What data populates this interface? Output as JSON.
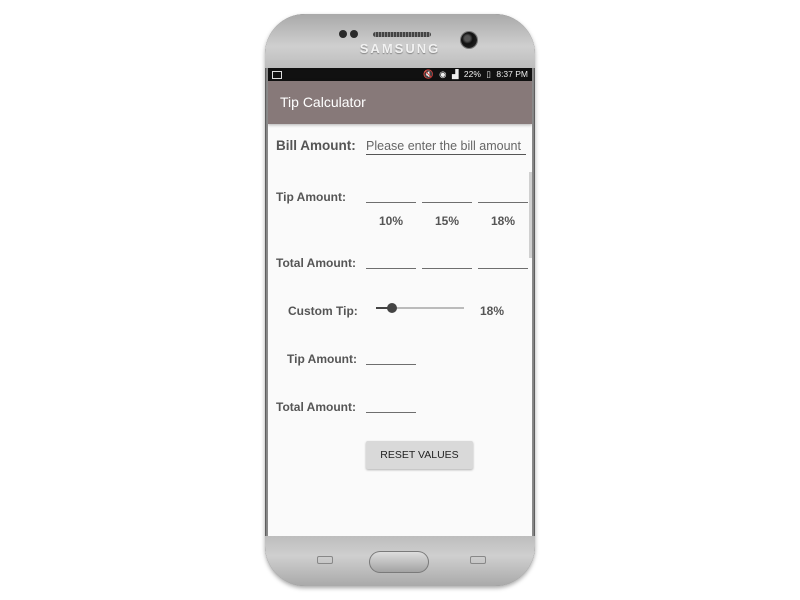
{
  "device": {
    "brand": "SAMSUNG"
  },
  "status_bar": {
    "battery": "22%",
    "time": "8:37 PM"
  },
  "app": {
    "title": "Tip Calculator"
  },
  "form": {
    "bill_label": "Bill Amount:",
    "bill_placeholder": "Please enter the bill amount",
    "bill_value": "",
    "tip_label": "Tip Amount:",
    "percentages": [
      "10%",
      "15%",
      "18%"
    ],
    "total_label": "Total Amount:",
    "custom_tip_label": "Custom Tip:",
    "custom_tip_value": "18%",
    "custom_tip_slider_fraction": 0.18,
    "custom_tip_amount_label": "Tip Amount:",
    "custom_total_label": "Total Amount:",
    "reset_label": "RESET VALUES"
  },
  "colors": {
    "app_bar": "#877979",
    "screen_bg": "#fafafa",
    "button_bg": "#d9d9d9"
  }
}
